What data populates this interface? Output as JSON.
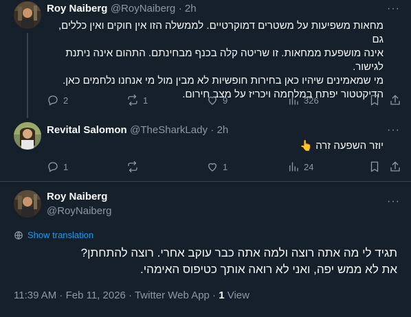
{
  "tweet1": {
    "name": "Roy Naiberg",
    "handle": "@RoyNaiberg",
    "time": "· 2h",
    "more": "···",
    "lines": [
      "מחאות משפיעות על משטרים דמוקרטיים. לממשלה הזו אין חוקים ואין כללים, גם",
      "אינה מושפעת ממחאות. זו שריטה קלה בכנף מבחינתם. התהום אינה ניתנת",
      "לגישור.",
      "מי שמאמינים שיהיו כאן בחירות חופשיות לא מבין מול מי אנחנו נלחמים כאן.",
      "הדיקטטור יפתח במלחמה ויכריז על מצב חירום."
    ],
    "replies": "2",
    "reposts": "1",
    "likes": "9",
    "views": "326"
  },
  "tweet2": {
    "name": "Revital Salomon",
    "handle": "@TheSharkLady",
    "time": "· 2h",
    "more": "···",
    "text": "יוזר השפעה זרה 👆",
    "replies": "1",
    "reposts": "",
    "likes": "1",
    "views": "24"
  },
  "tweet3": {
    "name": "Roy Naiberg",
    "handle": "@RoyNaiberg",
    "more": "···",
    "translate_label": "Show translation",
    "lines": [
      "תגיד לי מה אתה רוצה ולמה אתה כבר עוקב אחרי. רוצה להתחתן?",
      "את לא ממש יפה, ואני לא רואה אותך כטיפוס האימהי."
    ],
    "meta": "11:39 AM · Feb 11, 2026 · Twitter Web App · ",
    "views_count": "1",
    "views_label": " View"
  },
  "icons": [
    "reply-icon",
    "repost-icon",
    "like-icon",
    "views-icon",
    "bookmark-icon",
    "share-icon",
    "globe-icon"
  ],
  "colors": {
    "background": "#15202b",
    "text": "#f7f9f9",
    "secondary": "#8b98a5",
    "accent": "#1d9bf0",
    "border": "#38444d"
  }
}
